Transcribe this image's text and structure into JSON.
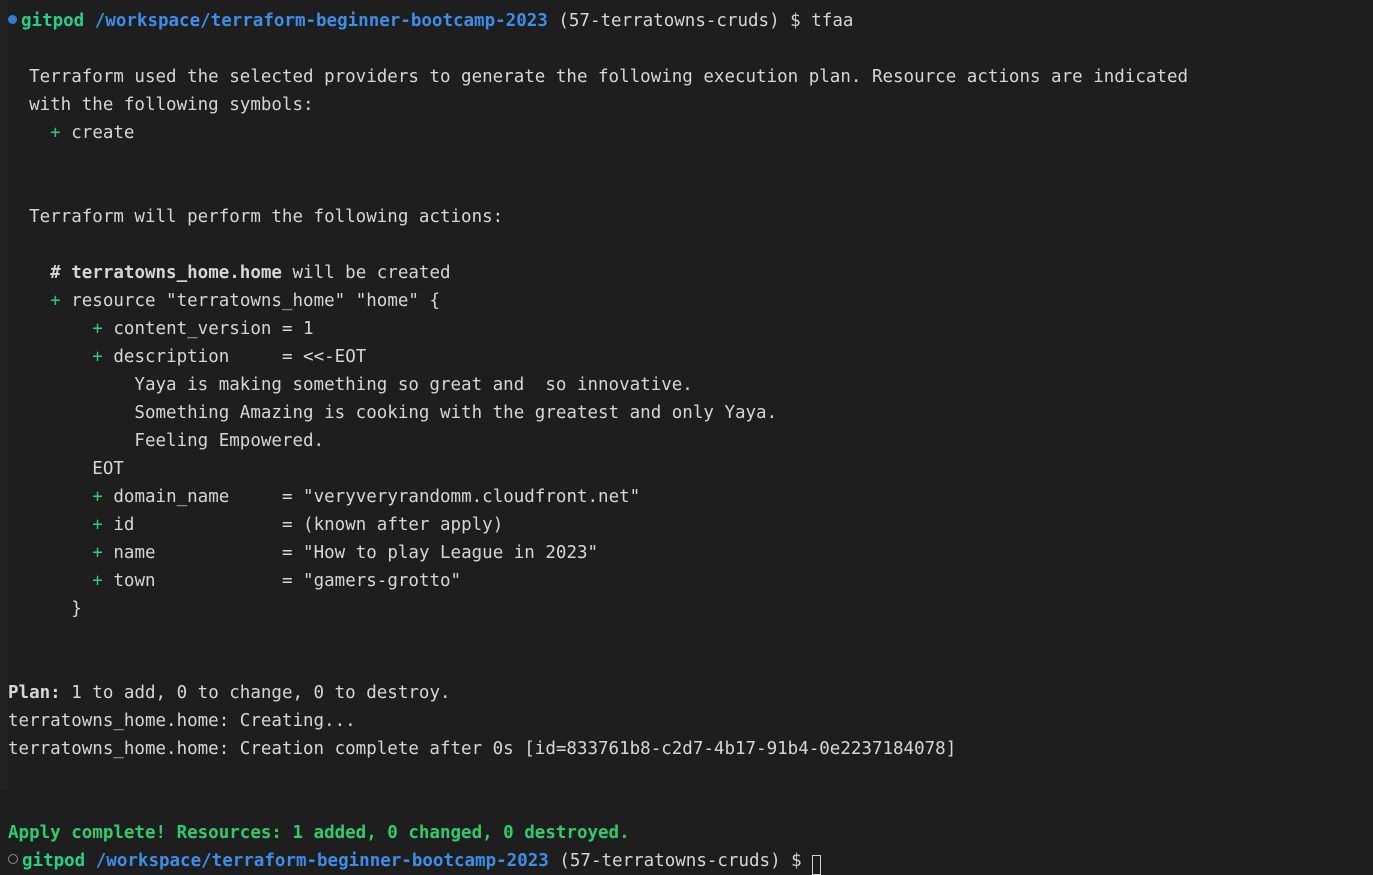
{
  "terminal": {
    "background_color": "#1e1e1e",
    "foreground_color": "#d6d6d6",
    "accent_green": "#23d18b",
    "accent_blue": "#3b8eea",
    "diff_add_color": "#2ecc71",
    "title": "gitpod terminal"
  },
  "prompt_top": {
    "bullet": "filled-circle-icon",
    "user": "gitpod",
    "path": "/workspace/terraform-beginner-bootcamp-2023",
    "branch": "(57-terratowns-cruds)",
    "sigil": "$",
    "command": "tfaa"
  },
  "prompt_bottom": {
    "bullet": "hollow-circle-icon",
    "user": "gitpod",
    "path": "/workspace/terraform-beginner-bootcamp-2023",
    "branch": "(57-terratowns-cruds)",
    "sigil": "$",
    "command": "",
    "cursor": "block-cursor"
  },
  "output": {
    "intro_line_1": "  Terraform used the selected providers to generate the following execution plan. Resource actions are indicated",
    "intro_line_2": "  with the following symbols:",
    "symbol_plus": "+",
    "symbol_plus_label": "create",
    "symbol_indent": "    ",
    "actions_header": "  Terraform will perform the following actions:",
    "resource_comment_indent": "    ",
    "resource_comment_hash": "# terratowns_home.home",
    "resource_comment_rest": " will be created",
    "resource_open_indent": "    ",
    "resource_open_plus": "+",
    "resource_open_text": " resource \"terratowns_home\" \"home\" {",
    "attributes": [
      {
        "indent": "        ",
        "plus": "+",
        "key": "content_version",
        "pad": " = ",
        "value": "1"
      },
      {
        "indent": "        ",
        "plus": "+",
        "key": "description    ",
        "pad": " = ",
        "value": "<<-EOT"
      }
    ],
    "heredoc_lines": [
      "            Yaya is making something so great and  so innovative.",
      "            Something Amazing is cooking with the greatest and only Yaya.",
      "            Feeling Empowered."
    ],
    "heredoc_terminator": "        EOT",
    "attributes_after": [
      {
        "indent": "        ",
        "plus": "+",
        "key": "domain_name    ",
        "pad": " = ",
        "value": "\"veryveryrandomm.cloudfront.net\""
      },
      {
        "indent": "        ",
        "plus": "+",
        "key": "id             ",
        "pad": " = ",
        "value": "(known after apply)"
      },
      {
        "indent": "        ",
        "plus": "+",
        "key": "name           ",
        "pad": " = ",
        "value": "\"How to play League in 2023\""
      },
      {
        "indent": "        ",
        "plus": "+",
        "key": "town           ",
        "pad": " = ",
        "value": "\"gamers-grotto\""
      }
    ],
    "resource_close": "      }",
    "plan_label": "Plan:",
    "plan_rest": " 1 to add, 0 to change, 0 to destroy.",
    "creating_line": "terratowns_home.home: Creating...",
    "creation_complete_line": "terratowns_home.home: Creation complete after 0s [id=833761b8-c2d7-4b17-91b4-0e2237184078]",
    "apply_complete_line": "Apply complete! Resources: 1 added, 0 changed, 0 destroyed."
  }
}
